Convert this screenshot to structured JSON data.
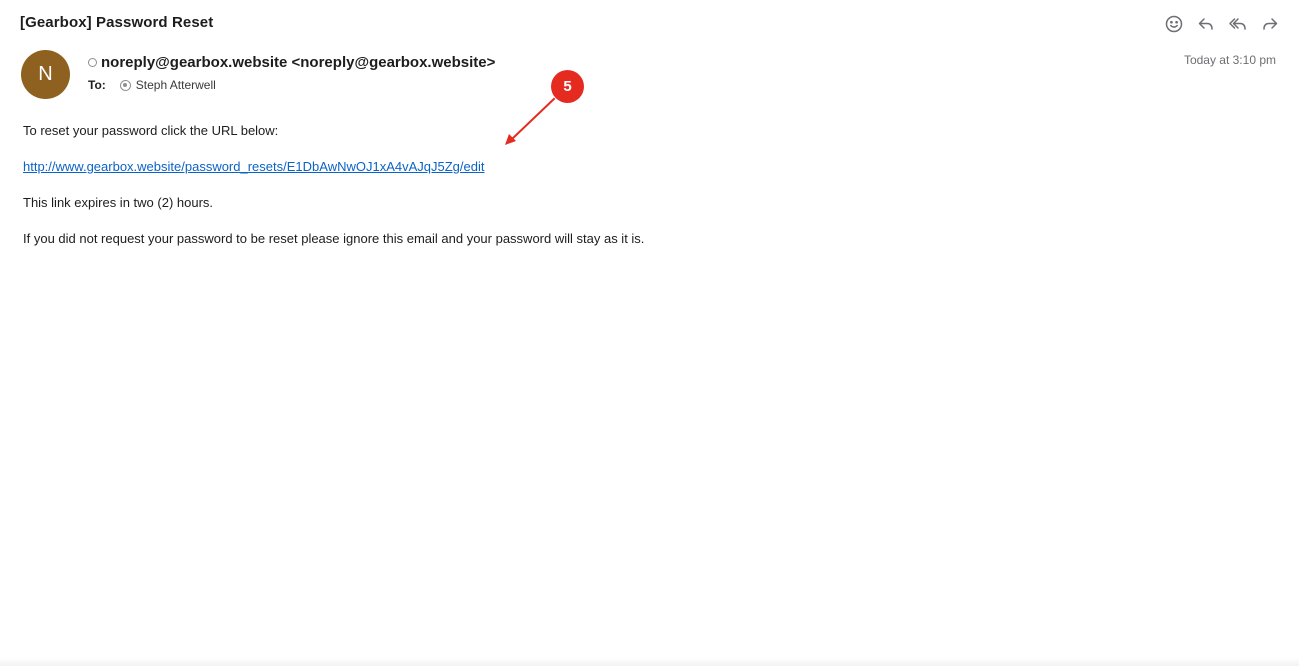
{
  "email": {
    "subject": "[Gearbox] Password Reset",
    "avatar_initial": "N",
    "sender": "noreply@gearbox.website <noreply@gearbox.website>",
    "to_label": "To:",
    "recipient": "Steph Atterwell",
    "timestamp": "Today at 3:10 pm",
    "body": {
      "line1": "To reset your password click the URL below:",
      "link": "http://www.gearbox.website/password_resets/E1DbAwNwOJ1xA4vAJqJ5Zg/edit",
      "line2": "This link expires in two (2) hours.",
      "line3": "If you did not request your password to be reset please ignore this email and your password will stay as it is."
    }
  },
  "toolbar": {
    "icons": [
      "emoji-icon",
      "reply-icon",
      "reply-all-icon",
      "forward-icon"
    ]
  },
  "annotation": {
    "badge_number": "5",
    "color": "#e52a1f"
  },
  "colors": {
    "avatar": "#8f6120",
    "link": "#0b63c7"
  }
}
